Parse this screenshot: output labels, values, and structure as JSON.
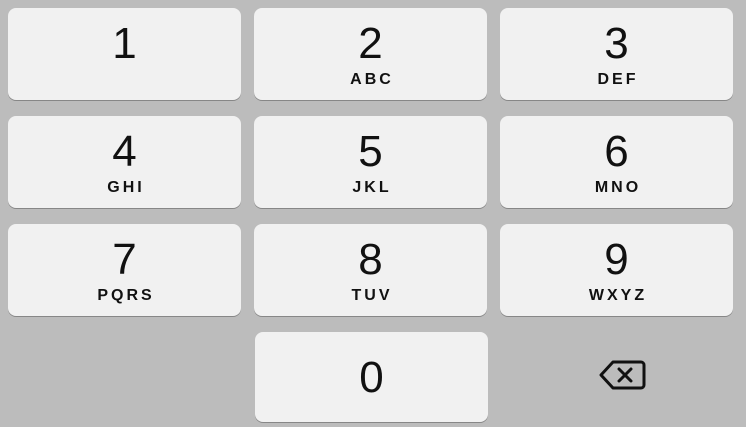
{
  "keypad": {
    "keys": [
      {
        "digit": "1",
        "letters": ""
      },
      {
        "digit": "2",
        "letters": "ABC"
      },
      {
        "digit": "3",
        "letters": "DEF"
      },
      {
        "digit": "4",
        "letters": "GHI"
      },
      {
        "digit": "5",
        "letters": "JKL"
      },
      {
        "digit": "6",
        "letters": "MNO"
      },
      {
        "digit": "7",
        "letters": "PQRS"
      },
      {
        "digit": "8",
        "letters": "TUV"
      },
      {
        "digit": "9",
        "letters": "WXYZ"
      },
      {
        "digit": "0",
        "letters": ""
      }
    ],
    "backspace_icon": "backspace-icon"
  }
}
